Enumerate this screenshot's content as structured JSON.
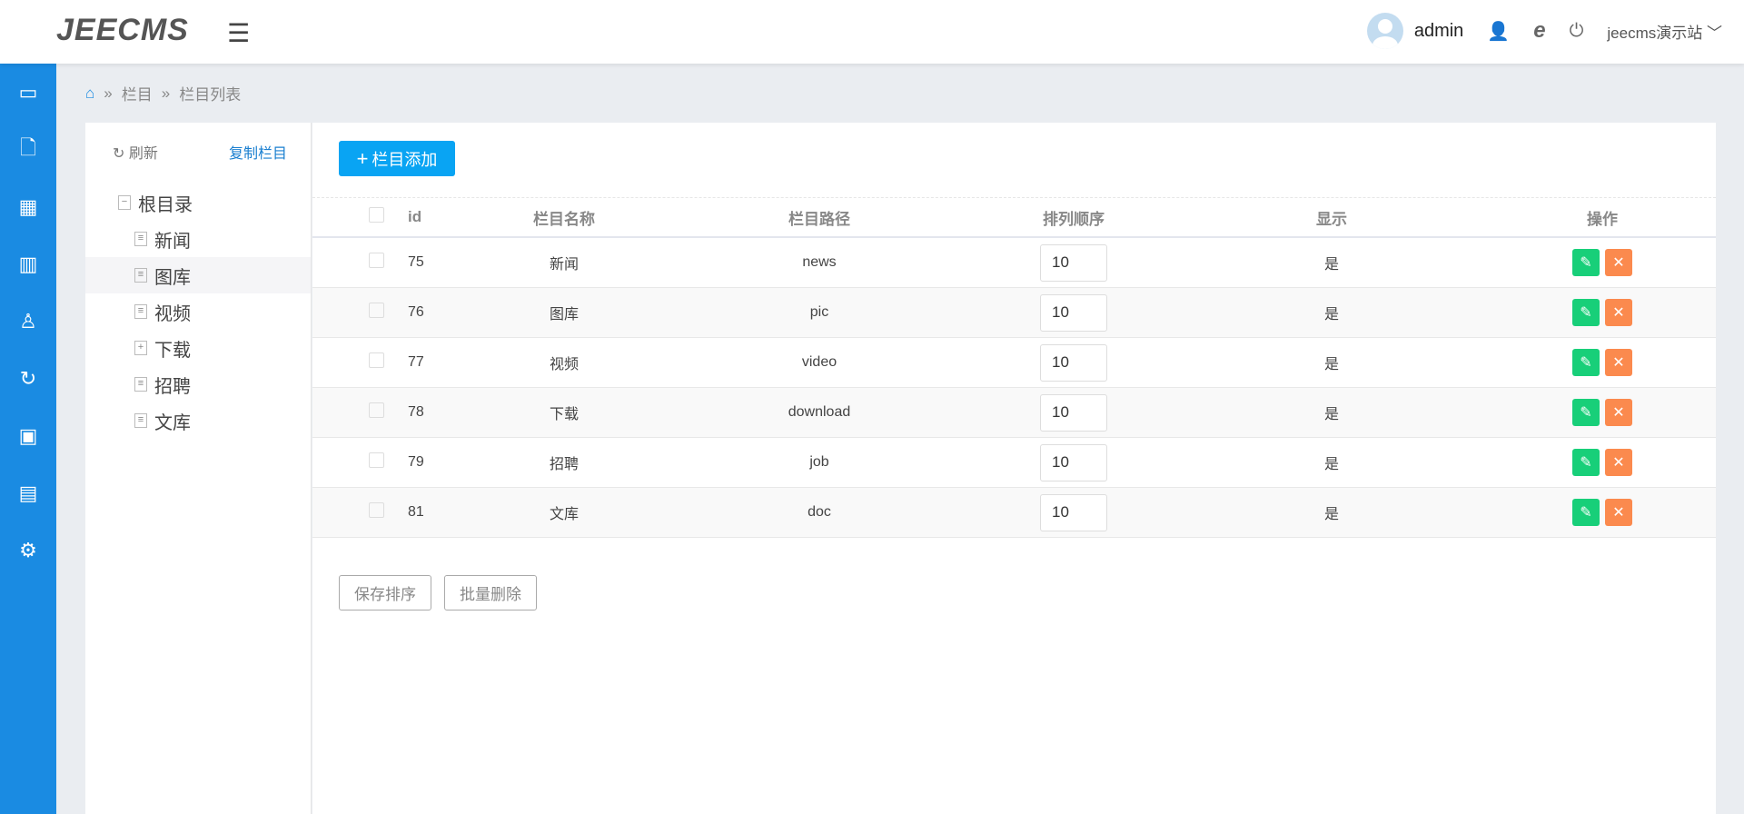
{
  "header": {
    "logo": "JEECMS",
    "menu_icon": "☰",
    "user": "admin",
    "site": "jeecms演示站",
    "icons": [
      "user-edit-icon",
      "browser-icon",
      "power-icon"
    ]
  },
  "sidebar": {
    "icons": [
      "monitor-icon",
      "document-icon",
      "grid-icon",
      "chart-icon",
      "user-icon",
      "refresh-circle-icon",
      "box-icon",
      "widgets-icon",
      "gear-icon"
    ]
  },
  "breadcrumb": {
    "sep": "»",
    "items": [
      "栏目",
      "栏目列表"
    ]
  },
  "tree": {
    "refresh": "刷新",
    "copy": "复制栏目",
    "root": "根目录",
    "nodes": [
      {
        "label": "新闻",
        "icon": "doc"
      },
      {
        "label": "图库",
        "icon": "doc"
      },
      {
        "label": "视频",
        "icon": "doc"
      },
      {
        "label": "下载",
        "icon": "plus"
      },
      {
        "label": "招聘",
        "icon": "doc"
      },
      {
        "label": "文库",
        "icon": "doc"
      }
    ]
  },
  "main": {
    "add_label": "栏目添加",
    "columns": [
      "id",
      "栏目名称",
      "栏目路径",
      "排列顺序",
      "显示",
      "操作"
    ],
    "rows": [
      {
        "id": "75",
        "name": "新闻",
        "path": "news",
        "order": "10",
        "show": "是"
      },
      {
        "id": "76",
        "name": "图库",
        "path": "pic",
        "order": "10",
        "show": "是"
      },
      {
        "id": "77",
        "name": "视频",
        "path": "video",
        "order": "10",
        "show": "是"
      },
      {
        "id": "78",
        "name": "下载",
        "path": "download",
        "order": "10",
        "show": "是"
      },
      {
        "id": "79",
        "name": "招聘",
        "path": "job",
        "order": "10",
        "show": "是"
      },
      {
        "id": "81",
        "name": "文库",
        "path": "doc",
        "order": "10",
        "show": "是"
      }
    ],
    "save_order": "保存排序",
    "batch_delete": "批量删除"
  },
  "colors": {
    "sidebar": "#1a8be2",
    "add": "#09a4f3",
    "edit": "#18cf79",
    "delete": "#fb8a4e"
  }
}
